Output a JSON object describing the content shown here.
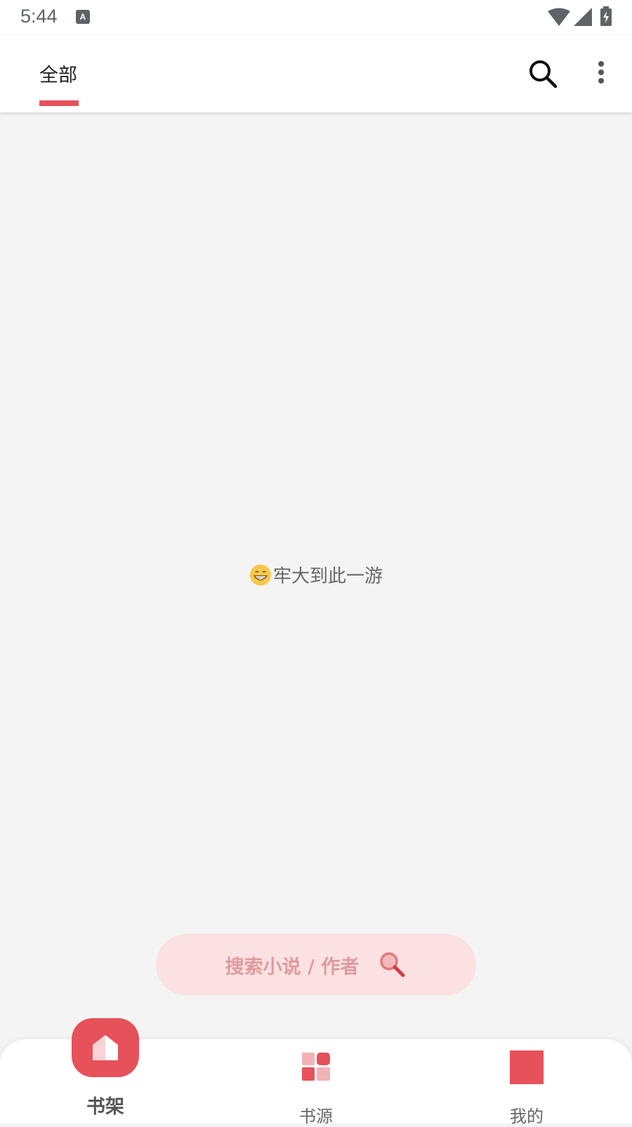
{
  "status_bar": {
    "time": "5:44",
    "icons": [
      "a-icon",
      "wifi-icon",
      "signal-icon",
      "battery-charging-icon"
    ]
  },
  "top_bar": {
    "tabs": [
      {
        "label": "全部",
        "active": true
      }
    ],
    "actions": [
      "search-icon",
      "more-vert-icon"
    ]
  },
  "empty_state": {
    "icon": "grinning-face-icon",
    "text": "牢大到此一游"
  },
  "search_pill": {
    "placeholder": "搜索小说 / 作者",
    "icon": "magnifier-icon"
  },
  "bottom_nav": {
    "items": [
      {
        "label": "书架",
        "icon": "home-icon",
        "active": true
      },
      {
        "label": "书源",
        "icon": "grid-icon",
        "active": false
      },
      {
        "label": "我的",
        "icon": "square-icon",
        "active": false
      }
    ]
  },
  "colors": {
    "accent": "#e6515a",
    "pill_bg": "#fbe1e2",
    "pill_text": "#df9a9e",
    "background": "#f4f4f4"
  }
}
